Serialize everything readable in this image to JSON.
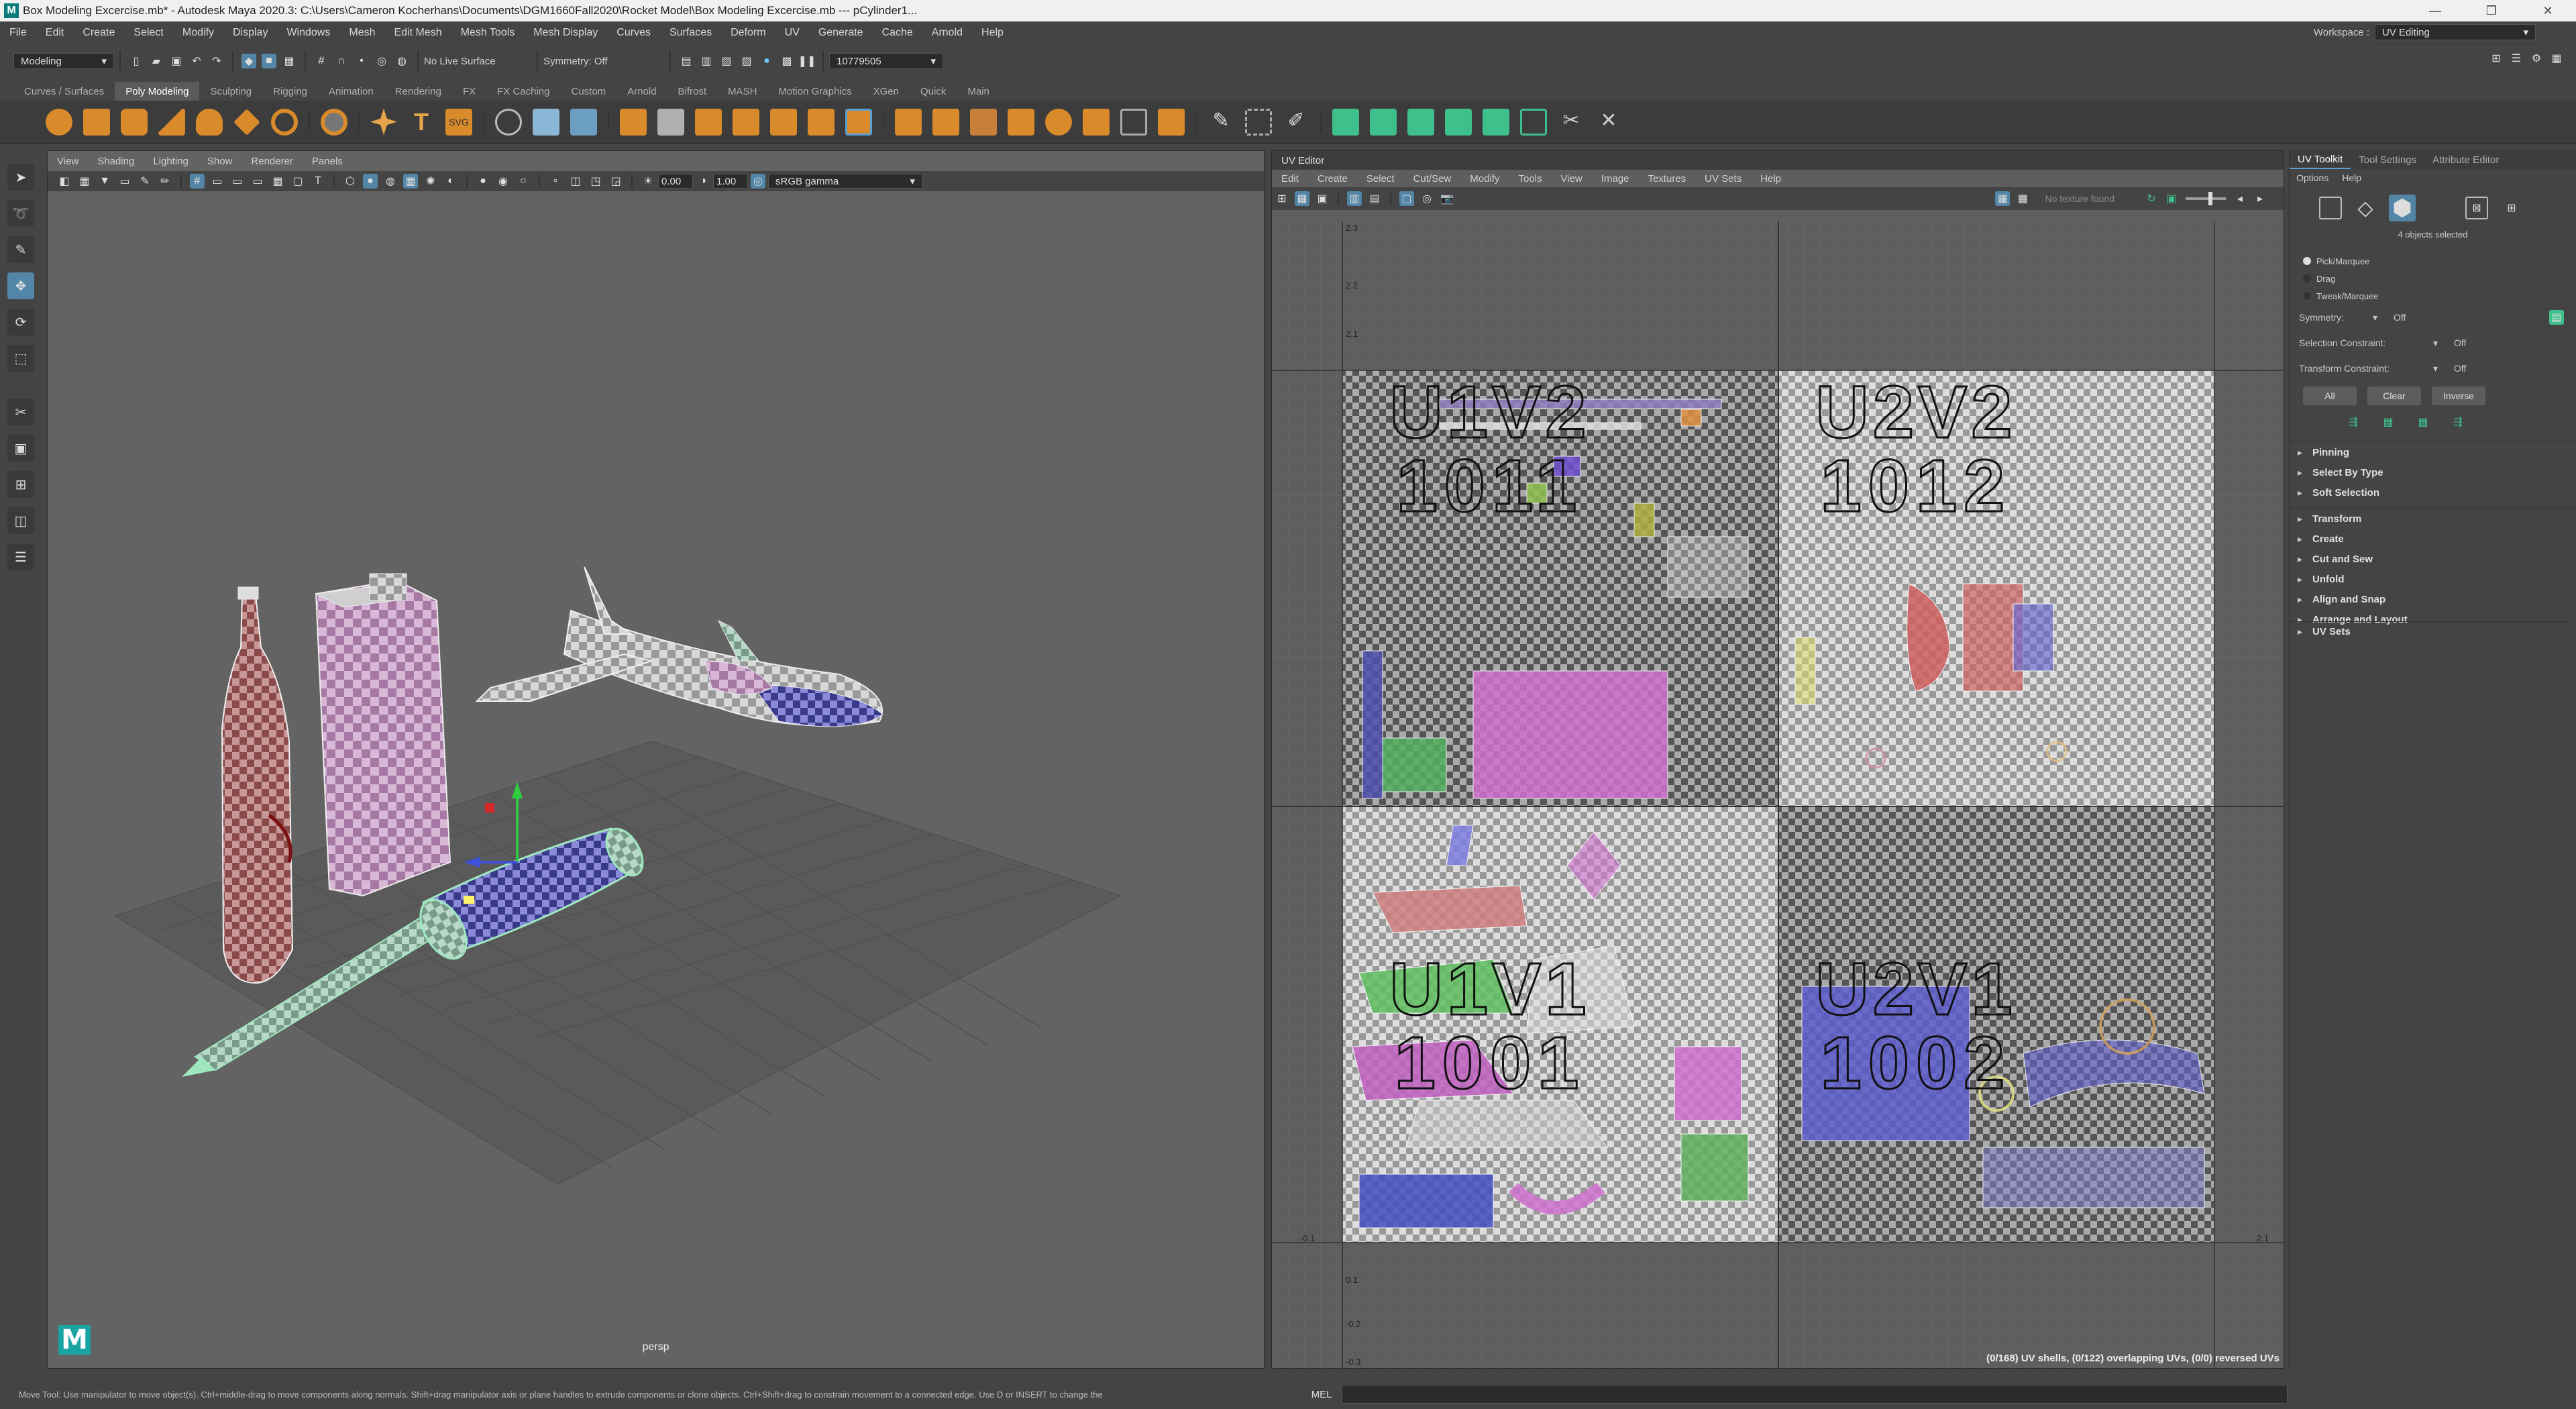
{
  "title": "Box Modeling Excercise.mb* - Autodesk Maya 2020.3: C:\\Users\\Cameron Kocherhans\\Documents\\DGM1660Fall2020\\Rocket Model\\Box Modeling Excercise.mb  ---  pCylinder1...",
  "menu": [
    "File",
    "Edit",
    "Create",
    "Select",
    "Modify",
    "Display",
    "Windows",
    "Mesh",
    "Edit Mesh",
    "Mesh Tools",
    "Mesh Display",
    "Curves",
    "Surfaces",
    "Deform",
    "UV",
    "Generate",
    "Cache",
    "Arnold",
    "Help"
  ],
  "workspace": {
    "label": "Workspace :",
    "value": "UV Editing"
  },
  "statusline": {
    "mode": "Modeling",
    "live_surface": "No Live Surface",
    "symmetry": "Symmetry: Off",
    "field": "10779505"
  },
  "shelf_tabs": [
    "Curves / Surfaces",
    "Poly Modeling",
    "Sculpting",
    "Rigging",
    "Animation",
    "Rendering",
    "FX",
    "FX Caching",
    "Custom",
    "Arnold",
    "Bifrost",
    "MASH",
    "Motion Graphics",
    "XGen",
    "Quick",
    "Main"
  ],
  "shelf_active": "Poly Modeling",
  "viewport": {
    "menus": [
      "View",
      "Shading",
      "Lighting",
      "Show",
      "Renderer",
      "Panels"
    ],
    "exposure": "0.00",
    "gamma": "1.00",
    "colorspace": "sRGB gamma",
    "camera": "persp"
  },
  "uv_editor": {
    "title": "UV Editor",
    "menus": [
      "Edit",
      "Create",
      "Select",
      "Cut/Sew",
      "Modify",
      "Tools",
      "View",
      "Image",
      "Textures",
      "UV Sets",
      "Help"
    ],
    "texture_status": "No texture found",
    "tiles": [
      {
        "label": "U1V2",
        "udim": "1011"
      },
      {
        "label": "U2V2",
        "udim": "1012"
      },
      {
        "label": "U1V1",
        "udim": "1001"
      },
      {
        "label": "U2V1",
        "udim": "1002"
      }
    ],
    "axis_top": [
      "2.3",
      "2.2",
      "2.1"
    ],
    "axis_bottom": [
      "-0.1",
      "0.1",
      "-0.2",
      "-0.3",
      "2.1"
    ],
    "stats": "(0/168) UV shells, (0/122) overlapping UVs, (0/0) reversed UVs"
  },
  "right_panel": {
    "tabs": [
      "UV Toolkit",
      "Tool Settings",
      "Attribute Editor"
    ],
    "submenu": [
      "Options",
      "Help"
    ],
    "selected_count": "4 objects selected",
    "modes": [
      "Pick/Marquee",
      "Drag",
      "Tweak/Marquee"
    ],
    "symmetry": {
      "label": "Symmetry:",
      "value": "Off"
    },
    "selection_constraint": {
      "label": "Selection Constraint:",
      "value": "Off"
    },
    "transform_constraint": {
      "label": "Transform Constraint:",
      "value": "Off"
    },
    "buttons": [
      "All",
      "Clear",
      "Inverse"
    ],
    "sections_a": [
      "Pinning",
      "Select By Type",
      "Soft Selection"
    ],
    "sections_b": [
      "Transform",
      "Create",
      "Cut and Sew",
      "Unfold",
      "Align and Snap",
      "Arrange and Layout"
    ],
    "bottom_section": "UV Sets"
  },
  "helpline": "Move Tool: Use manipulator to move object(s). Ctrl+middle-drag to move components along normals. Shift+drag manipulator axis or plane handles to extrude components or clone objects. Ctrl+Shift+drag to constrain movement to a connected edge. Use D or INSERT to change the",
  "mel_label": "MEL",
  "colors": {
    "accent": "#5285a6",
    "active_blue": "#5a9fd4",
    "logo": "#0a7a7a"
  }
}
